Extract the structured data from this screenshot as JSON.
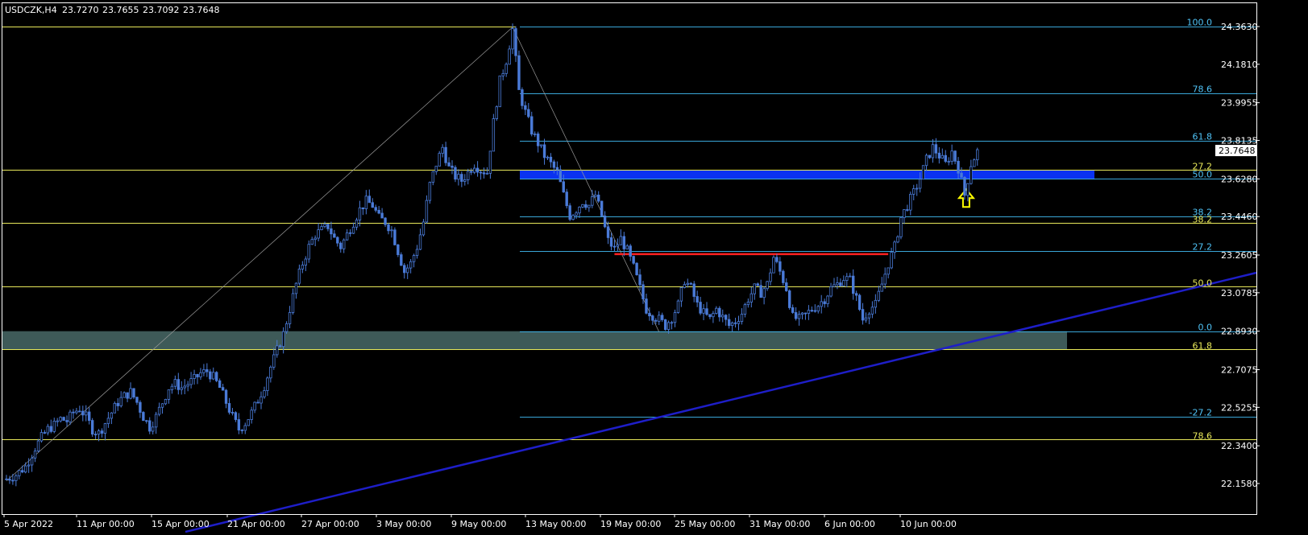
{
  "header": {
    "symbol": "USDCZK,H4",
    "open": "23.7270",
    "high": "23.7655",
    "low": "23.7092",
    "close": "23.7648"
  },
  "colors": {
    "background": "#000000",
    "frame": "#FFFFFF",
    "candle": "#4A7BD8",
    "fib_major": "#E8E85A",
    "fib_minor": "#3AA6D8",
    "fib_minor_label": "#4FC3F7",
    "blue_zone": "#0A32F0",
    "support_zone": "#3E5A58",
    "trendline": "#1E1EC8",
    "resistance_line": "#FF2020",
    "arrow": "#FFFF00",
    "text": "#FFFFFF"
  },
  "chart_data": {
    "type": "candlestick",
    "title": "USDCZK,H4",
    "ylim": [
      22.12,
      24.38
    ],
    "y_ticks": [
      "24.3630",
      "24.1810",
      "23.9955",
      "23.8135",
      "23.6280",
      "23.4460",
      "23.2605",
      "23.0785",
      "22.8930",
      "22.7075",
      "22.5255",
      "22.3400",
      "22.1580"
    ],
    "x_ticks": [
      "5 Apr 2022",
      "11 Apr 00:00",
      "15 Apr 00:00",
      "21 Apr 00:00",
      "27 Apr 00:00",
      "3 May 00:00",
      "9 May 00:00",
      "13 May 00:00",
      "19 May 00:00",
      "25 May 00:00",
      "31 May 00:00",
      "6 Jun 00:00",
      "10 Jun 00:00"
    ],
    "current_price": "23.7648",
    "price_path": [
      [
        0,
        22.18
      ],
      [
        3,
        22.2
      ],
      [
        6,
        22.24
      ],
      [
        9,
        22.33
      ],
      [
        11,
        22.38
      ],
      [
        13,
        22.42
      ],
      [
        15,
        22.44
      ],
      [
        17,
        22.47
      ],
      [
        19,
        22.46
      ],
      [
        21,
        22.5
      ],
      [
        23,
        22.52
      ],
      [
        25,
        22.48
      ],
      [
        27,
        22.42
      ],
      [
        29,
        22.4
      ],
      [
        31,
        22.45
      ],
      [
        33,
        22.5
      ],
      [
        35,
        22.55
      ],
      [
        37,
        22.58
      ],
      [
        39,
        22.6
      ],
      [
        41,
        22.55
      ],
      [
        43,
        22.48
      ],
      [
        45,
        22.43
      ],
      [
        47,
        22.48
      ],
      [
        49,
        22.55
      ],
      [
        51,
        22.62
      ],
      [
        53,
        22.64
      ],
      [
        55,
        22.62
      ],
      [
        57,
        22.64
      ],
      [
        59,
        22.66
      ],
      [
        61,
        22.69
      ],
      [
        63,
        22.7
      ],
      [
        65,
        22.67
      ],
      [
        67,
        22.62
      ],
      [
        69,
        22.55
      ],
      [
        71,
        22.48
      ],
      [
        73,
        22.42
      ],
      [
        75,
        22.45
      ],
      [
        77,
        22.5
      ],
      [
        79,
        22.56
      ],
      [
        81,
        22.63
      ],
      [
        83,
        22.72
      ],
      [
        85,
        22.8
      ],
      [
        87,
        22.88
      ],
      [
        89,
        23.0
      ],
      [
        91,
        23.12
      ],
      [
        93,
        23.22
      ],
      [
        95,
        23.3
      ],
      [
        97,
        23.36
      ],
      [
        99,
        23.38
      ],
      [
        101,
        23.4
      ],
      [
        103,
        23.34
      ],
      [
        105,
        23.3
      ],
      [
        107,
        23.36
      ],
      [
        109,
        23.42
      ],
      [
        111,
        23.48
      ],
      [
        113,
        23.52
      ],
      [
        115,
        23.5
      ],
      [
        117,
        23.44
      ],
      [
        119,
        23.42
      ],
      [
        121,
        23.38
      ],
      [
        123,
        23.28
      ],
      [
        125,
        23.18
      ],
      [
        127,
        23.22
      ],
      [
        129,
        23.3
      ],
      [
        131,
        23.42
      ],
      [
        133,
        23.6
      ],
      [
        135,
        23.7
      ],
      [
        137,
        23.78
      ],
      [
        139,
        23.68
      ],
      [
        141,
        23.64
      ],
      [
        143,
        23.62
      ],
      [
        145,
        23.66
      ],
      [
        147,
        23.7
      ],
      [
        149,
        23.67
      ],
      [
        151,
        23.66
      ],
      [
        153,
        23.9
      ],
      [
        155,
        24.1
      ],
      [
        157,
        24.2
      ],
      [
        159,
        24.35
      ],
      [
        161,
        24.05
      ],
      [
        163,
        23.95
      ],
      [
        165,
        23.86
      ],
      [
        167,
        23.8
      ],
      [
        169,
        23.74
      ],
      [
        171,
        23.7
      ],
      [
        173,
        23.66
      ],
      [
        175,
        23.55
      ],
      [
        177,
        23.45
      ],
      [
        179,
        23.48
      ],
      [
        181,
        23.52
      ],
      [
        183,
        23.5
      ],
      [
        185,
        23.55
      ],
      [
        187,
        23.45
      ],
      [
        189,
        23.33
      ],
      [
        191,
        23.29
      ],
      [
        193,
        23.34
      ],
      [
        195,
        23.28
      ],
      [
        197,
        23.2
      ],
      [
        199,
        23.1
      ],
      [
        201,
        23.0
      ],
      [
        203,
        22.97
      ],
      [
        205,
        22.95
      ],
      [
        207,
        22.92
      ],
      [
        209,
        22.96
      ],
      [
        211,
        23.02
      ],
      [
        213,
        23.14
      ],
      [
        215,
        23.1
      ],
      [
        217,
        23.02
      ],
      [
        219,
        22.98
      ],
      [
        221,
        22.95
      ],
      [
        223,
        23.0
      ],
      [
        225,
        22.96
      ],
      [
        227,
        22.92
      ],
      [
        229,
        22.94
      ],
      [
        231,
        22.98
      ],
      [
        233,
        23.05
      ],
      [
        235,
        23.1
      ],
      [
        237,
        23.08
      ],
      [
        239,
        23.12
      ],
      [
        241,
        23.25
      ],
      [
        243,
        23.18
      ],
      [
        245,
        23.1
      ],
      [
        247,
        22.96
      ],
      [
        249,
        22.95
      ],
      [
        251,
        22.97
      ],
      [
        253,
        23.0
      ],
      [
        255,
        23.02
      ],
      [
        257,
        23.05
      ],
      [
        259,
        23.1
      ],
      [
        261,
        23.12
      ],
      [
        263,
        23.15
      ],
      [
        265,
        23.14
      ],
      [
        267,
        23.05
      ],
      [
        269,
        22.95
      ],
      [
        271,
        23.0
      ],
      [
        273,
        23.02
      ],
      [
        275,
        23.12
      ],
      [
        277,
        23.22
      ],
      [
        279,
        23.3
      ],
      [
        281,
        23.44
      ],
      [
        283,
        23.5
      ],
      [
        285,
        23.56
      ],
      [
        287,
        23.63
      ],
      [
        289,
        23.72
      ],
      [
        291,
        23.78
      ],
      [
        293,
        23.74
      ],
      [
        295,
        23.7
      ],
      [
        297,
        23.76
      ],
      [
        299,
        23.68
      ],
      [
        301,
        23.55
      ],
      [
        303,
        23.7
      ],
      [
        305,
        23.76
      ]
    ],
    "fib_primary": {
      "color": "major",
      "levels": [
        {
          "label": "27.2",
          "price": 23.672
        },
        {
          "label": "38.2",
          "price": 23.415
        },
        {
          "label": "50.0",
          "price": 23.11
        },
        {
          "label": "61.8",
          "price": 22.806
        },
        {
          "label": "78.6",
          "price": 22.37
        }
      ],
      "top": 24.363
    },
    "fib_secondary": {
      "color": "minor",
      "levels": [
        {
          "label": "100.0",
          "price": 24.363
        },
        {
          "label": "78.6",
          "price": 24.04
        },
        {
          "label": "61.8",
          "price": 23.81
        },
        {
          "label": "50.0",
          "price": 23.63
        },
        {
          "label": "38.2",
          "price": 23.448
        },
        {
          "label": "27.2",
          "price": 23.28
        },
        {
          "label": "0.0",
          "price": 22.893
        },
        {
          "label": "-27.2",
          "price": 22.48
        }
      ]
    },
    "zones": [
      {
        "name": "resistance-zone",
        "price_top": 23.67,
        "price_bottom": 23.625,
        "color": "blue_zone"
      },
      {
        "name": "support-zone",
        "price_top": 22.893,
        "price_bottom": 22.806,
        "color": "support_zone"
      }
    ],
    "resistance_level": 23.265,
    "trendline": {
      "from": [
        0,
        22.08
      ],
      "to": [
        340,
        23.19
      ]
    },
    "arrow": {
      "bar": 302,
      "price": 23.5
    }
  }
}
